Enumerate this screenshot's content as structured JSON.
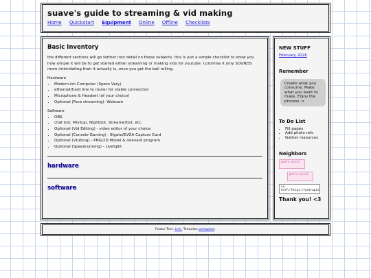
{
  "header": {
    "title": "suave's guide to streaming & vid making",
    "nav": [
      "Home",
      "Quickstart",
      "Equipment",
      "Online",
      "Offline",
      "Checklists"
    ]
  },
  "main": {
    "heading": "Basic Inventory",
    "intro": "the different sections will go farther into detail on these subjects. this is just a simple checklist to show you how simple it will be to get started either streaming or making vids for youtube. I promise it only SOUNDS more intimidating than it actually is, once you get the ball rolling.",
    "hardware_label": "Hardware",
    "hardware_items": [
      "Modern-ish Computer (Specs Vary)",
      "ethernet/hard line to router for stable connection",
      "Microphone & Headset (of your choice)",
      "Optional (Face streaming)- Webcam"
    ],
    "software_label": "Software",
    "software_items": [
      "OBS",
      "chat bot; Mixitup, Nightbot, Streamerbot, etc.",
      "Optional (Vid Editing) - video editor of your choice",
      "Optional (Console Gaming) - Elgato/EVGA Capture Card",
      "Optional (Vtubing) - PNG/2D Model & relevant program",
      "Optional (Speedrunning) - LiveSplit"
    ],
    "section_hardware": "hardware",
    "section_software": "software"
  },
  "sidebar": {
    "new_stuff_heading": "NEW STUFF",
    "new_stuff_link": "February 2026",
    "remember_heading": "Remember",
    "remember_text": "Create what you consume. Make what you want to make. Enjoy the process. o",
    "todo_heading": "To Do List",
    "todo_items": [
      "Fill pages",
      "Add photo refs",
      "Gather resources"
    ],
    "neighbors_heading": "Neighbors",
    "badge1": "petra pixel",
    "badge2": "petra pixel",
    "code_text": "<a href=\"https://petrapix.",
    "thanks": "Thank you! <3"
  },
  "footer": {
    "prefix": "Footer Text.",
    "link": "Link.",
    "template_prefix": "Template",
    "template_link": "petrapixel"
  },
  "colors": {
    "grid_line": "#c9d6ea",
    "link": "#1a1ad8",
    "panel_bg": "#f4f4f4",
    "section_title": "#0e0e8a",
    "bubble_bg": "#cfcfcf"
  }
}
